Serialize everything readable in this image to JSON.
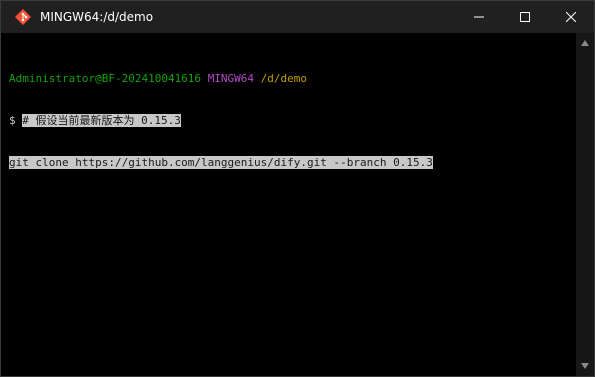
{
  "window": {
    "title": "MINGW64:/d/demo",
    "icon": "git-bash-icon",
    "controls": [
      "minimize-icon",
      "maximize-icon",
      "close-icon"
    ]
  },
  "terminal": {
    "prompt_user": "Administrator@BF-202410041616",
    "prompt_shell": "MINGW64",
    "prompt_path": "/d/demo",
    "prompt_symbol": "$",
    "line2": "# 假设当前最新版本为 0.15.3",
    "line3": "git clone https://github.com/langgenius/dify.git --branch 0.15.3"
  },
  "colors": {
    "user": "#13a10e",
    "shell": "#b148c6",
    "path": "#c19c00",
    "selection": "#c8c8c8"
  }
}
